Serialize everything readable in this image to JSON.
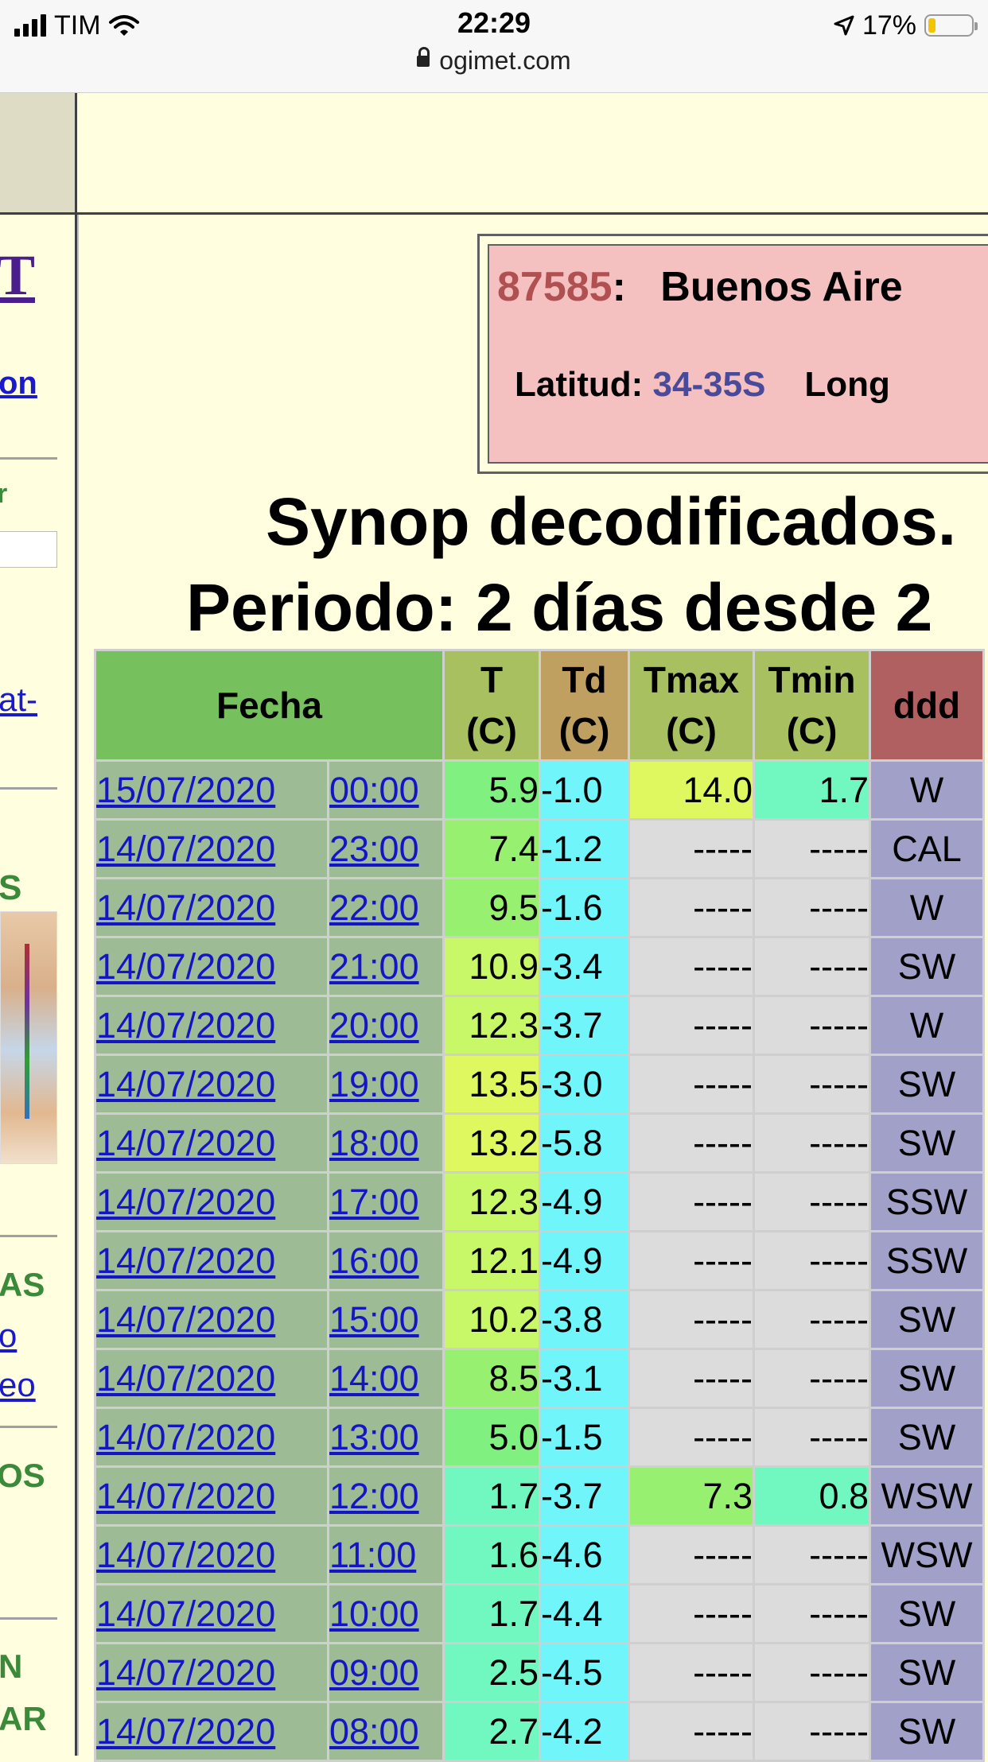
{
  "status_bar": {
    "carrier": "TIM",
    "time": "22:29",
    "battery": "17%",
    "battery_level": 0.17,
    "url": "ogimet.com"
  },
  "left_column": {
    "t": "T",
    "on": "on",
    "g1": "r",
    "at": "at-",
    "s": "S",
    "as": "AS",
    "o": "o",
    "eo": "eo",
    "os": "OS",
    "n": "N",
    "ar": "AR"
  },
  "station": {
    "code": "87585",
    "colon": ":",
    "name": "Buenos Aire",
    "lat_label": "Latitud:",
    "lat_value": "34-35S",
    "lon_label": "Long"
  },
  "titles": {
    "line1": "Synop decodificados.",
    "line2": "Periodo: 2 días desde 2"
  },
  "table": {
    "headers": {
      "fecha": "Fecha",
      "t": [
        "T",
        "(C)"
      ],
      "td": [
        "Td",
        "(C)"
      ],
      "tmax": [
        "Tmax",
        "(C)"
      ],
      "tmin": [
        "Tmin",
        "(C)"
      ],
      "ddd": "ddd"
    },
    "rows": [
      {
        "date": "15/07/2020",
        "time": "00:00",
        "t": "5.9",
        "td": "-1.0",
        "tmax": "14.0",
        "tmin": "1.7",
        "ddd": "W",
        "t_color": "#80f080",
        "tmax_color": "#e0f860",
        "tmin_color": "#70f8c0"
      },
      {
        "date": "14/07/2020",
        "time": "23:00",
        "t": "7.4",
        "td": "-1.2",
        "tmax": "-----",
        "tmin": "-----",
        "ddd": "CAL",
        "t_color": "#98f070"
      },
      {
        "date": "14/07/2020",
        "time": "22:00",
        "t": "9.5",
        "td": "-1.6",
        "tmax": "-----",
        "tmin": "-----",
        "ddd": "W",
        "t_color": "#98f070"
      },
      {
        "date": "14/07/2020",
        "time": "21:00",
        "t": "10.9",
        "td": "-3.4",
        "tmax": "-----",
        "tmin": "-----",
        "ddd": "SW",
        "t_color": "#c8f868"
      },
      {
        "date": "14/07/2020",
        "time": "20:00",
        "t": "12.3",
        "td": "-3.7",
        "tmax": "-----",
        "tmin": "-----",
        "ddd": "W",
        "t_color": "#c8f868"
      },
      {
        "date": "14/07/2020",
        "time": "19:00",
        "t": "13.5",
        "td": "-3.0",
        "tmax": "-----",
        "tmin": "-----",
        "ddd": "SW",
        "t_color": "#e0f860"
      },
      {
        "date": "14/07/2020",
        "time": "18:00",
        "t": "13.2",
        "td": "-5.8",
        "tmax": "-----",
        "tmin": "-----",
        "ddd": "SW",
        "t_color": "#e0f860"
      },
      {
        "date": "14/07/2020",
        "time": "17:00",
        "t": "12.3",
        "td": "-4.9",
        "tmax": "-----",
        "tmin": "-----",
        "ddd": "SSW",
        "t_color": "#c8f868"
      },
      {
        "date": "14/07/2020",
        "time": "16:00",
        "t": "12.1",
        "td": "-4.9",
        "tmax": "-----",
        "tmin": "-----",
        "ddd": "SSW",
        "t_color": "#c8f868"
      },
      {
        "date": "14/07/2020",
        "time": "15:00",
        "t": "10.2",
        "td": "-3.8",
        "tmax": "-----",
        "tmin": "-----",
        "ddd": "SW",
        "t_color": "#c8f868"
      },
      {
        "date": "14/07/2020",
        "time": "14:00",
        "t": "8.5",
        "td": "-3.1",
        "tmax": "-----",
        "tmin": "-----",
        "ddd": "SW",
        "t_color": "#98f070"
      },
      {
        "date": "14/07/2020",
        "time": "13:00",
        "t": "5.0",
        "td": "-1.5",
        "tmax": "-----",
        "tmin": "-----",
        "ddd": "SW",
        "t_color": "#80f080"
      },
      {
        "date": "14/07/2020",
        "time": "12:00",
        "t": "1.7",
        "td": "-3.7",
        "tmax": "7.3",
        "tmin": "0.8",
        "ddd": "WSW",
        "t_color": "#70f8c0",
        "tmax_color": "#98f070",
        "tmin_color": "#70f8c0"
      },
      {
        "date": "14/07/2020",
        "time": "11:00",
        "t": "1.6",
        "td": "-4.6",
        "tmax": "-----",
        "tmin": "-----",
        "ddd": "WSW",
        "t_color": "#70f8c0"
      },
      {
        "date": "14/07/2020",
        "time": "10:00",
        "t": "1.7",
        "td": "-4.4",
        "tmax": "-----",
        "tmin": "-----",
        "ddd": "SW",
        "t_color": "#70f8c0"
      },
      {
        "date": "14/07/2020",
        "time": "09:00",
        "t": "2.5",
        "td": "-4.5",
        "tmax": "-----",
        "tmin": "-----",
        "ddd": "SW",
        "t_color": "#70f8c0"
      },
      {
        "date": "14/07/2020",
        "time": "08:00",
        "t": "2.7",
        "td": "-4.2",
        "tmax": "-----",
        "tmin": "-----",
        "ddd": "SW",
        "t_color": "#70f8c0"
      }
    ]
  }
}
